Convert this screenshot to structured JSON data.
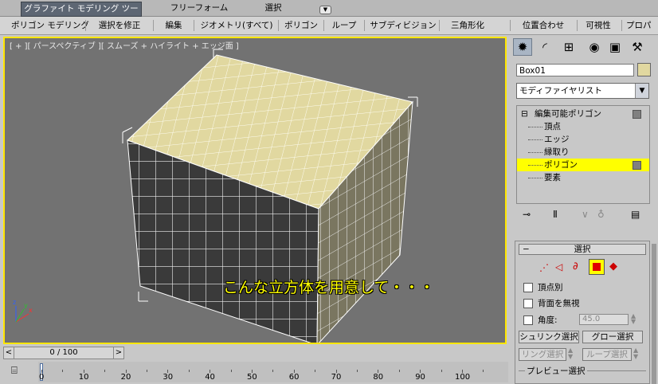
{
  "tabs": {
    "graphite": "グラファイト モデリング ツール",
    "freeform": "フリーフォーム",
    "selection": "選択"
  },
  "ribbon": {
    "polygon_modeling": "ポリゴン モデリング",
    "modify_selection": "選択を修正",
    "edit": "編集",
    "geometry_all": "ジオメトリ(すべて)",
    "polygons": "ポリゴン",
    "loops": "ループ",
    "subdivision": "サブディビジョン",
    "triangulation": "三角形化",
    "align": "位置合わせ",
    "visibility": "可視性",
    "properties": "プロパ"
  },
  "viewport": {
    "label": "[ + ][ パースペクティブ ][ スムーズ + ハイライト + エッジ面 ]",
    "subtitle": "こんな立方体を用意して・・・"
  },
  "panel": {
    "object_name": "Box01",
    "object_color": "#e1d8a0",
    "modifier_list": "モディファイヤリスト",
    "stack": {
      "root": "編集可能ポリゴン",
      "items": [
        "頂点",
        "エッジ",
        "縁取り",
        "ポリゴン",
        "要素"
      ],
      "selected": "ポリゴン"
    },
    "selection_rollout": {
      "title": "選択",
      "by_vertex": "頂点別",
      "ignore_backfacing": "背面を無視",
      "angle_label": "角度:",
      "angle_value": "45.0",
      "shrink": "シュリンク選択",
      "grow": "グロー選択",
      "ring": "リング選択",
      "loop": "ループ選択",
      "preview": "プレビュー選択"
    }
  },
  "timeline": {
    "frame_text": "0 / 100",
    "prev": "<",
    "next": ">",
    "ticks": [
      "0",
      "10",
      "20",
      "30",
      "40",
      "50",
      "60",
      "70",
      "80",
      "90",
      "100"
    ]
  },
  "colors": {
    "viewport_bg": "#727272",
    "active_border": "#ffe600",
    "cube_top": "#e1d8a0",
    "cube_front": "#3a3a3a",
    "cube_side": "#7a7660",
    "subtitle": "#ffff00"
  }
}
